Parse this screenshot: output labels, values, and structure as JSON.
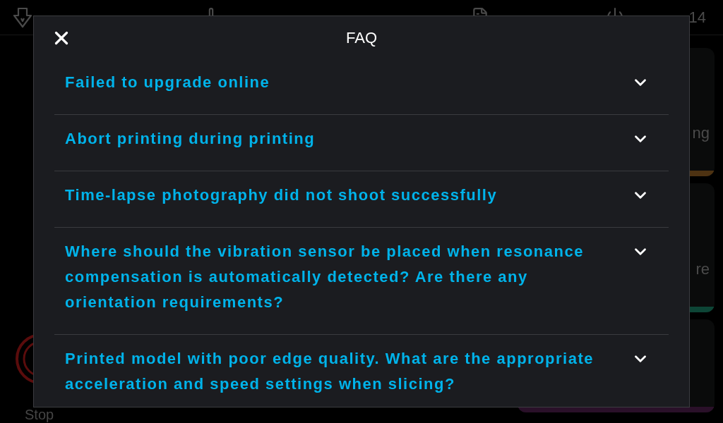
{
  "status_bar": {
    "time": "14"
  },
  "stop_button": {
    "label": "Stop"
  },
  "side_cards": [
    {
      "label": "ng",
      "color": "#4d3212"
    },
    {
      "label": "re",
      "color": "#0d4536"
    },
    {
      "color": "#2a1029"
    }
  ],
  "dialog": {
    "title": "FAQ",
    "items": [
      {
        "question": "Failed to upgrade online",
        "expanded": false
      },
      {
        "question": "Abort printing during printing",
        "expanded": false
      },
      {
        "question": "Time-lapse photography did not shoot successfully",
        "expanded": false
      },
      {
        "question": "Where should the vibration sensor be placed when resonance compensation is automatically detected? Are there any orientation requirements?",
        "expanded": false
      },
      {
        "question": "Printed model with poor edge quality. What are the appropriate acceleration and speed settings when slicing?",
        "expanded": false
      }
    ]
  }
}
